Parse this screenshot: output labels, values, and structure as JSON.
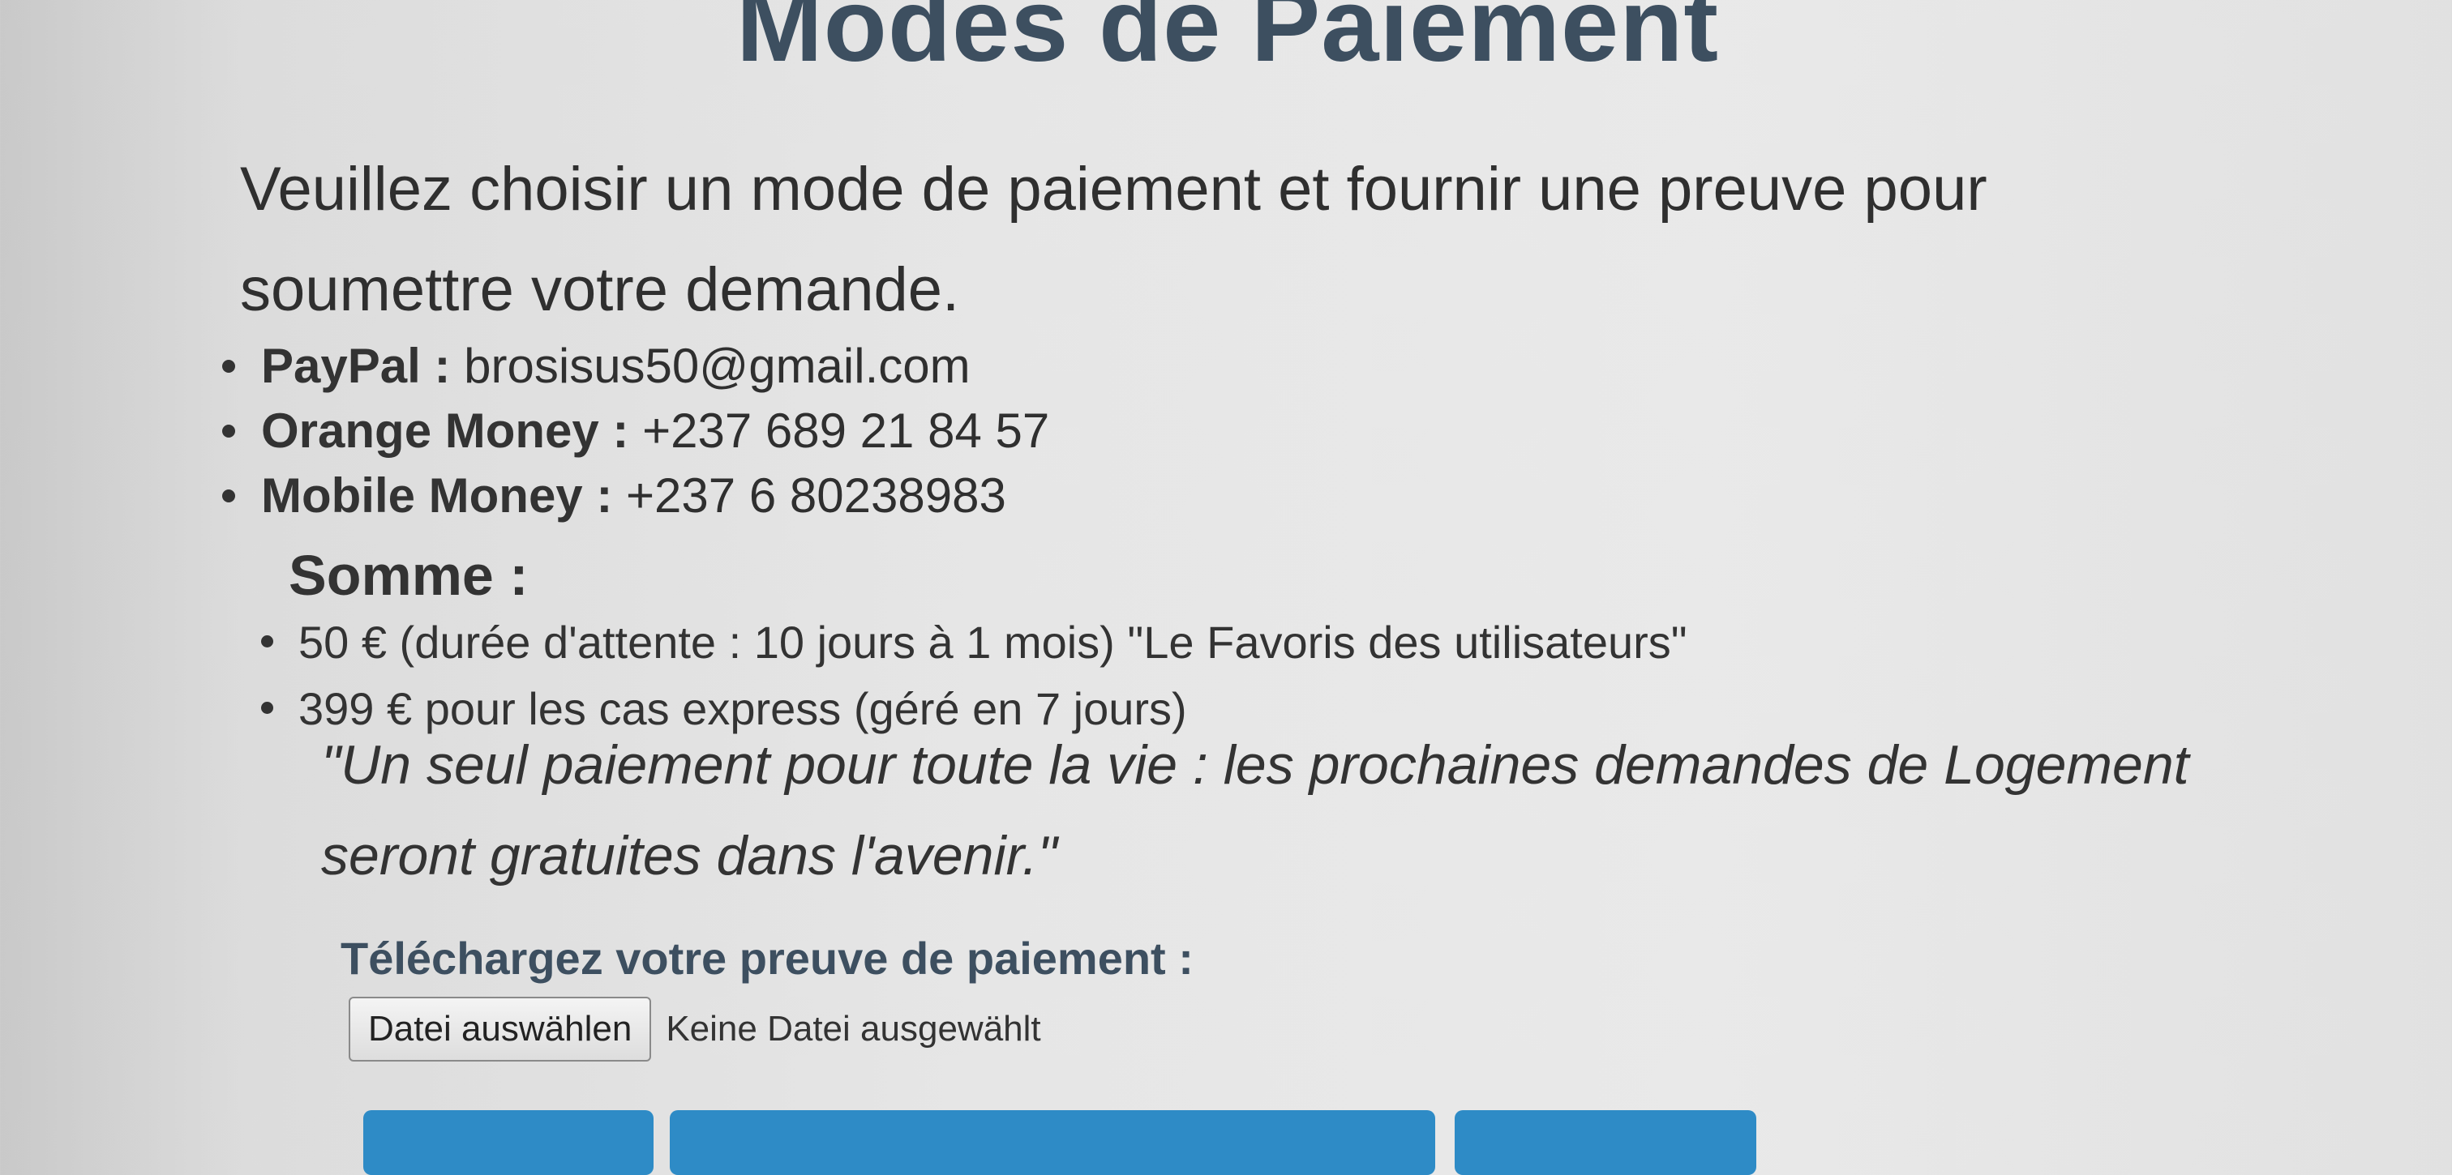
{
  "page": {
    "title": "Modes de Paiement",
    "intro": "Veuillez choisir un mode de paiement et fournir une preuve pour soumettre votre demande."
  },
  "payment_methods": [
    {
      "name": "PayPal :",
      "value": "brosisus50@gmail.com"
    },
    {
      "name": "Orange Money :",
      "value": "+237 689 21 84 57"
    },
    {
      "name": "Mobile Money :",
      "value": "+237 6 80238983"
    }
  ],
  "sum": {
    "heading": "Somme :",
    "options": [
      "50 € (durée d'attente : 10 jours à 1 mois) \"Le Favoris des utilisateurs\"",
      "399 € pour les cas express (géré en 7 jours)"
    ],
    "quote": "\"Un seul paiement pour toute la vie : les prochaines demandes de Logement seront gratuites dans l'avenir.\""
  },
  "upload": {
    "label": "Téléchargez votre preuve de paiement :",
    "button_label": "Datei auswählen",
    "status": "Keine Datei ausgewählt"
  },
  "colors": {
    "title": "#3d4f60",
    "button_blue": "#2e8bc6"
  }
}
